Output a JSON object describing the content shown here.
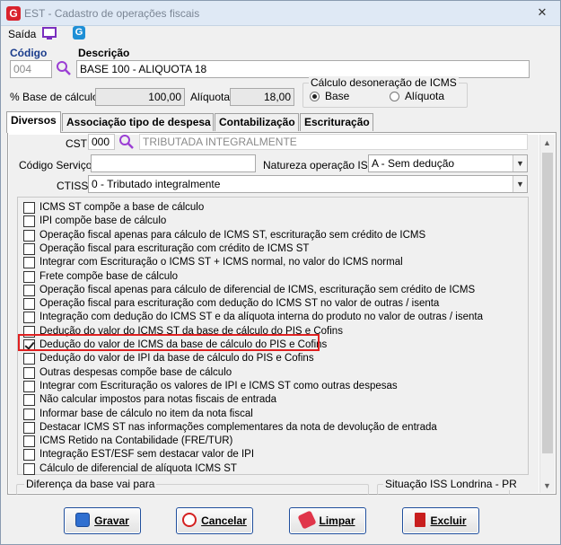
{
  "window": {
    "title": "EST - Cadastro de operações fiscais",
    "app_icon": "G"
  },
  "menu": {
    "saida": "Saída"
  },
  "header": {
    "codigo_label": "Código",
    "codigo_value": "004",
    "descricao_label": "Descrição",
    "descricao_value": "BASE 100 - ALIQUOTA 18",
    "base_calculo_label": "% Base de cálculo",
    "base_calculo_value": "100,00",
    "aliquota_label": "Alíquota",
    "aliquota_value": "18,00",
    "desoneracao": {
      "title": "Cálculo desoneração de ICMS",
      "options": [
        "Base",
        "Alíquota"
      ],
      "selected": "Base"
    }
  },
  "tabs": [
    "Diversos",
    "Associação tipo de despesa",
    "Contabilização",
    "Escrituração"
  ],
  "active_tab": "Diversos",
  "form": {
    "cst_label": "CST",
    "cst_code": "000",
    "cst_desc": "TRIBUTADA INTEGRALMENTE",
    "codigo_servico_label": "Código Serviço",
    "codigo_servico_value": "",
    "natureza_label": "Natureza operação ISS",
    "natureza_value": "A - Sem dedução",
    "ctiss_label": "CTISS",
    "ctiss_value": "0 - Tributado integralmente"
  },
  "checkboxes": [
    {
      "label": "ICMS ST compõe a base de cálculo",
      "checked": false
    },
    {
      "label": "IPI compõe base de cálculo",
      "checked": false
    },
    {
      "label": "Operação fiscal apenas para cálculo de ICMS ST, escrituração sem crédito de ICMS",
      "checked": false
    },
    {
      "label": "Operação fiscal para escrituração com crédito de ICMS ST",
      "checked": false
    },
    {
      "label": "Integrar com Escrituração o ICMS ST + ICMS normal,  no valor do ICMS normal",
      "checked": false
    },
    {
      "label": "Frete compõe base de cálculo",
      "checked": false
    },
    {
      "label": "Operação fiscal apenas para cálculo de diferencial de ICMS, escrituração sem crédito de ICMS",
      "checked": false
    },
    {
      "label": "Operação fiscal para escrituração com dedução do ICMS ST no valor de outras / isenta",
      "checked": false
    },
    {
      "label": "Integração com dedução do ICMS ST e da alíquota interna do produto no valor de outras / isenta",
      "checked": false
    },
    {
      "label": "Dedução do valor do ICMS ST da base de cálculo do PIS e Cofins",
      "checked": false
    },
    {
      "label": "Dedução do valor de ICMS da base de cálculo do PIS e Cofins",
      "checked": true
    },
    {
      "label": "Dedução do valor de IPI da base de cálculo do PIS e Cofins",
      "checked": false
    },
    {
      "label": "Outras despesas compõe base de cálculo",
      "checked": false
    },
    {
      "label": "Integrar com Escrituração os valores de IPI e ICMS ST como outras despesas",
      "checked": false
    },
    {
      "label": "Não calcular impostos para notas fiscais de entrada",
      "checked": false
    },
    {
      "label": "Informar base de cálculo no item da nota fiscal",
      "checked": false
    },
    {
      "label": "Destacar ICMS ST nas informações complementares da nota de devolução de entrada",
      "checked": false
    },
    {
      "label": "ICMS Retido na Contabilidade (FRE/TUR)",
      "checked": false
    },
    {
      "label": "Integração EST/ESF sem destacar valor de IPI",
      "checked": false
    },
    {
      "label": "Cálculo de diferencial de alíquota ICMS ST",
      "checked": false
    }
  ],
  "groups": {
    "diferenca": "Diferença da base vai para",
    "situacao_iss": "Situação ISS Londrina - PR"
  },
  "buttons": {
    "gravar": "Gravar",
    "cancelar": "Cancelar",
    "limpar": "Limpar",
    "excluir": "Excluir"
  },
  "colors": {
    "accent": "#1a3c8c",
    "highlight": "#e02020",
    "icon_purple": "#7a2fbf"
  }
}
